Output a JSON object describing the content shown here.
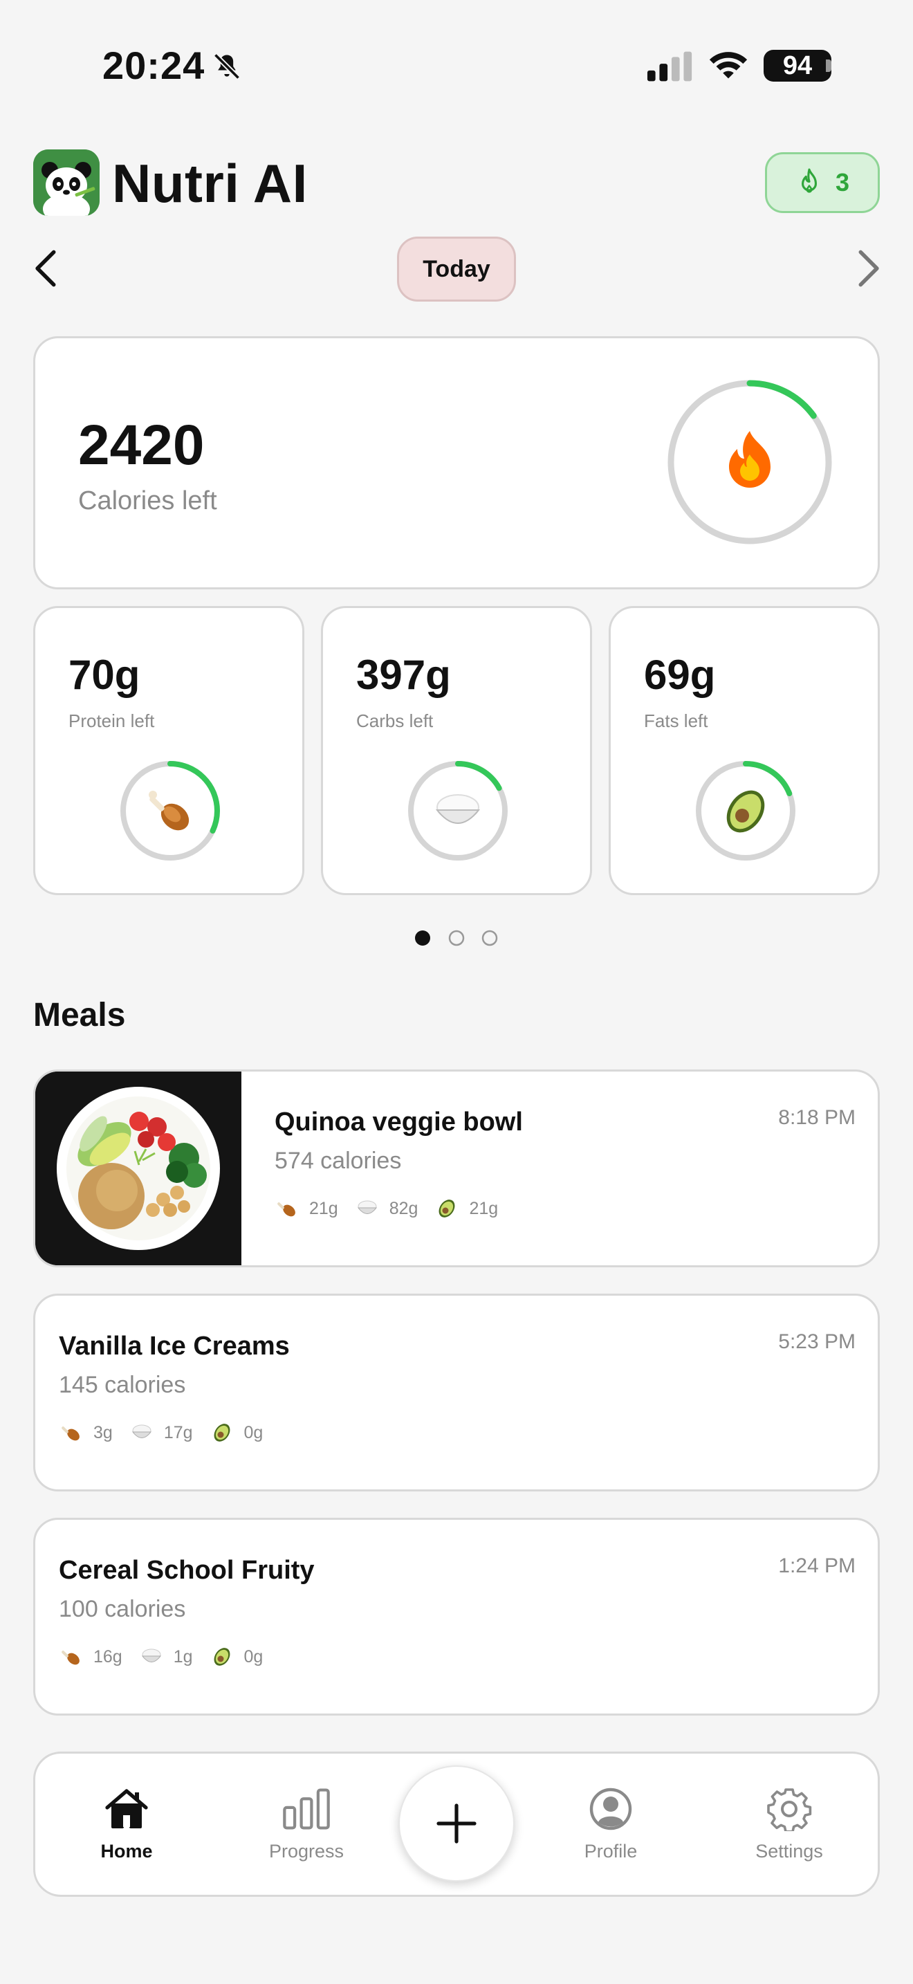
{
  "status_bar": {
    "time": "20:24",
    "battery": "94",
    "icons": [
      "bell-slash-icon",
      "cellular-signal-icon",
      "wifi-icon",
      "battery-icon"
    ]
  },
  "header": {
    "app_name": "Nutri AI",
    "logo_icon": "panda-logo",
    "streak": {
      "icon": "flame-icon",
      "count": "3"
    }
  },
  "date_nav": {
    "label": "Today",
    "prev_icon": "chevron-left-icon",
    "next_icon": "chevron-right-icon"
  },
  "calories": {
    "value": "2420",
    "label": "Calories left",
    "icon": "fire-emoji",
    "progress": 0.15
  },
  "macros": [
    {
      "value": "70g",
      "label": "Protein left",
      "icon": "drumstick-emoji",
      "progress": 0.32
    },
    {
      "value": "397g",
      "label": "Carbs left",
      "icon": "rice-bowl-emoji",
      "progress": 0.17
    },
    {
      "value": "69g",
      "label": "Fats left",
      "icon": "avocado-emoji",
      "progress": 0.19
    }
  ],
  "pager": {
    "count": 3,
    "active": 0
  },
  "meals": {
    "heading": "Meals",
    "items": [
      {
        "name": "Quinoa veggie bowl",
        "calories": "574 calories",
        "time": "8:18 PM",
        "protein": "21g",
        "carbs": "82g",
        "fats": "21g",
        "has_photo": true
      },
      {
        "name": "Vanilla Ice Creams",
        "calories": "145 calories",
        "time": "5:23 PM",
        "protein": "3g",
        "carbs": "17g",
        "fats": "0g",
        "has_photo": false
      },
      {
        "name": "Cereal School Fruity",
        "calories": "100 calories",
        "time": "1:24 PM",
        "protein": "16g",
        "carbs": "1g",
        "fats": "0g",
        "has_photo": false
      }
    ]
  },
  "bottom_nav": {
    "items": [
      {
        "label": "Home",
        "icon": "home-icon",
        "active": true
      },
      {
        "label": "Progress",
        "icon": "bar-chart-icon",
        "active": false
      },
      {
        "label": "Profile",
        "icon": "person-circle-icon",
        "active": false
      },
      {
        "label": "Settings",
        "icon": "gear-icon",
        "active": false
      }
    ],
    "add_icon": "plus-icon"
  },
  "colors": {
    "accent_green": "#34c759",
    "ring_track": "#d5d5d5",
    "streak_bg": "#d9f2db",
    "today_bg": "#f3dede",
    "text_secondary": "#8a8a8a"
  }
}
